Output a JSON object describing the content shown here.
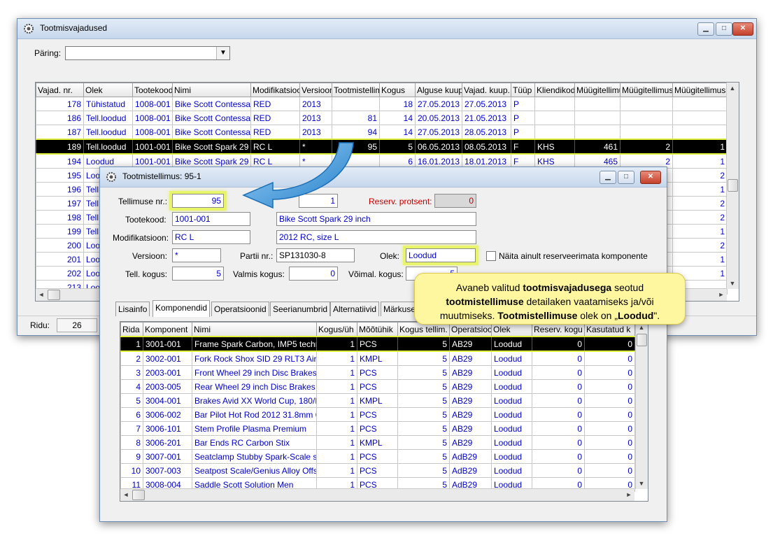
{
  "main_window": {
    "title": "Tootmisvajadused",
    "query_label": "Päring:",
    "query_value": "",
    "rows_label": "Ridu:",
    "rows_count": "26",
    "columns": [
      "Vajad. nr.",
      "Olek",
      "Tootekood",
      "Nimi",
      "Modifikatsiood",
      "Versioon",
      "Tootmistellim",
      "Kogus",
      "Alguse kuup",
      "Vajad. kuup.",
      "Tüüp",
      "Kliendikod",
      "Müügitellimu",
      "Müügitellimus",
      "Müügitellimus"
    ],
    "rows": [
      [
        "178",
        "Tühistatud",
        "1008-001",
        "Bike Scott Contessa",
        "RED",
        "2013",
        "",
        "18",
        "27.05.2013",
        "27.05.2013",
        "P",
        "",
        "",
        "",
        ""
      ],
      [
        "186",
        "Tell.loodud",
        "1008-001",
        "Bike Scott Contessa",
        "RED",
        "2013",
        "81",
        "14",
        "20.05.2013",
        "21.05.2013",
        "P",
        "",
        "",
        "",
        ""
      ],
      [
        "187",
        "Tell.loodud",
        "1008-001",
        "Bike Scott Contessa",
        "RED",
        "2013",
        "94",
        "14",
        "27.05.2013",
        "28.05.2013",
        "P",
        "",
        "",
        "",
        ""
      ],
      [
        "189",
        "Tell.loodud",
        "1001-001",
        "Bike Scott Spark 29",
        "RC L",
        "*",
        "95",
        "5",
        "06.05.2013",
        "08.05.2013",
        "F",
        "KHS",
        "461",
        "2",
        "1"
      ],
      [
        "194",
        "Loodud",
        "1001-001",
        "Bike Scott Spark 29",
        "RC L",
        "*",
        "",
        "6",
        "16.01.2013",
        "18.01.2013",
        "F",
        "KHS",
        "465",
        "2",
        "1"
      ],
      [
        "195",
        "Loo",
        "",
        "",
        "",
        "",
        "",
        "",
        "",
        "",
        "",
        "",
        "",
        "",
        "2"
      ],
      [
        "196",
        "Tell",
        "",
        "",
        "",
        "",
        "",
        "",
        "",
        "",
        "",
        "",
        "",
        "",
        "1"
      ],
      [
        "197",
        "Tell",
        "",
        "",
        "",
        "",
        "",
        "",
        "",
        "",
        "",
        "",
        "",
        "",
        "2"
      ],
      [
        "198",
        "Tell",
        "",
        "",
        "",
        "",
        "",
        "",
        "",
        "",
        "",
        "",
        "",
        "",
        "2"
      ],
      [
        "199",
        "Tell",
        "",
        "",
        "",
        "",
        "",
        "",
        "",
        "",
        "",
        "",
        "",
        "",
        "1"
      ],
      [
        "200",
        "Loo",
        "",
        "",
        "",
        "",
        "",
        "",
        "",
        "",
        "",
        "",
        "",
        "",
        "2"
      ],
      [
        "201",
        "Loo",
        "",
        "",
        "",
        "",
        "",
        "",
        "",
        "",
        "",
        "",
        "",
        "",
        "1"
      ],
      [
        "202",
        "Loo",
        "",
        "",
        "",
        "",
        "",
        "",
        "",
        "",
        "",
        "",
        "",
        "",
        "1"
      ],
      [
        "213",
        "Loo",
        "",
        "",
        "",
        "",
        "",
        "",
        "",
        "",
        "",
        "",
        "",
        "",
        ""
      ]
    ]
  },
  "order_window": {
    "title": "Tootmistellimus: 95-1",
    "order_nr_label": "Tellimuse nr.:",
    "order_nr": "95",
    "order_nr_suffix": "1",
    "reserv_label": "Reserv. protsent:",
    "reserv_value": "0",
    "product_code_label": "Tootekood:",
    "product_code": "1001-001",
    "product_name": "Bike Scott Spark 29 inch",
    "modification_label": "Modifikatsioon:",
    "modification": "RC L",
    "modification_desc": "2012 RC, size L",
    "version_label": "Versioon:",
    "version": "*",
    "batch_label": "Partii nr.:",
    "batch": "SP131030-8",
    "status_label": "Olek:",
    "status": "Loodud",
    "checkbox_label": "Näita ainult reserveerimata komponente",
    "order_qty_label": "Tell. kogus:",
    "order_qty": "5",
    "done_qty_label": "Valmis kogus:",
    "done_qty": "0",
    "possible_qty_label": "Võimal. kogus:",
    "possible_qty": "5",
    "tabs": [
      "Lisainfo",
      "Komponendid",
      "Operatsioonid",
      "Seerianumbrid",
      "Alternatiivid",
      "Märkuse"
    ],
    "columns": [
      "Rida",
      "Komponent",
      "Nimi",
      "Kogus/üh",
      "Mõõtühik",
      "Kogus tellim.",
      "Operatsioo",
      "Olek",
      "Reserv. kogu",
      "Kasutatud k"
    ],
    "rows": [
      [
        "1",
        "3001-001",
        "Frame Spark Carbon, IMP5 techno",
        "1",
        "PCS",
        "5",
        "AB29",
        "Loodud",
        "0",
        "0"
      ],
      [
        "2",
        "3002-001",
        "Fork Rock Shox SID 29 RLT3 Air,",
        "1",
        "KMPL",
        "5",
        "AB29",
        "Loodud",
        "0",
        "0"
      ],
      [
        "3",
        "2003-001",
        "Front Wheel 29 inch Disc Brakes",
        "1",
        "PCS",
        "5",
        "AB29",
        "Loodud",
        "0",
        "0"
      ],
      [
        "4",
        "2003-005",
        "Rear Wheel 29 inch Disc Brakes",
        "1",
        "PCS",
        "5",
        "AB29",
        "Loodud",
        "0",
        "0"
      ],
      [
        "5",
        "3004-001",
        "Brakes Avid XX World Cup, 180/F",
        "1",
        "KMPL",
        "5",
        "AB29",
        "Loodud",
        "0",
        "0"
      ],
      [
        "6",
        "3006-002",
        "Bar Pilot Hot Rod 2012 31.8mm 68",
        "1",
        "PCS",
        "5",
        "AB29",
        "Loodud",
        "0",
        "0"
      ],
      [
        "7",
        "3006-101",
        "Stem Profile Plasma Premium",
        "1",
        "PCS",
        "5",
        "AB29",
        "Loodud",
        "0",
        "0"
      ],
      [
        "8",
        "3006-201",
        "Bar Ends RC Carbon Stix",
        "1",
        "KMPL",
        "5",
        "AB29",
        "Loodud",
        "0",
        "0"
      ],
      [
        "9",
        "3007-001",
        "Seatclamp Stubby Spark-Scale stc",
        "1",
        "PCS",
        "5",
        "AdB29",
        "Loodud",
        "0",
        "0"
      ],
      [
        "10",
        "3007-003",
        "Seatpost Scale/Genius Alloy Offse",
        "1",
        "PCS",
        "5",
        "AdB29",
        "Loodud",
        "0",
        "0"
      ],
      [
        "11",
        "3008-004",
        "Saddle Scott Solution Men",
        "1",
        "PCS",
        "5",
        "AdB29",
        "Loodud",
        "0",
        "0"
      ]
    ]
  },
  "callout": {
    "p1": "Avaneb valitud ",
    "b1": "tootmisvajadusega",
    "p2": " seotud ",
    "b2": "tootmistellimuse",
    "p3": " detailaken vaatamiseks ja/või muutmiseks. ",
    "b3": "Tootmistellimuse",
    "p4": " olek on „",
    "b4": "Loodud",
    "p5": "\"."
  },
  "colors": {
    "text_blue": "#0000c8",
    "highlight": "#e8f46a",
    "selection": "#000000",
    "callout_bg": "#fff6a0",
    "arrow": "#3a9be0"
  }
}
